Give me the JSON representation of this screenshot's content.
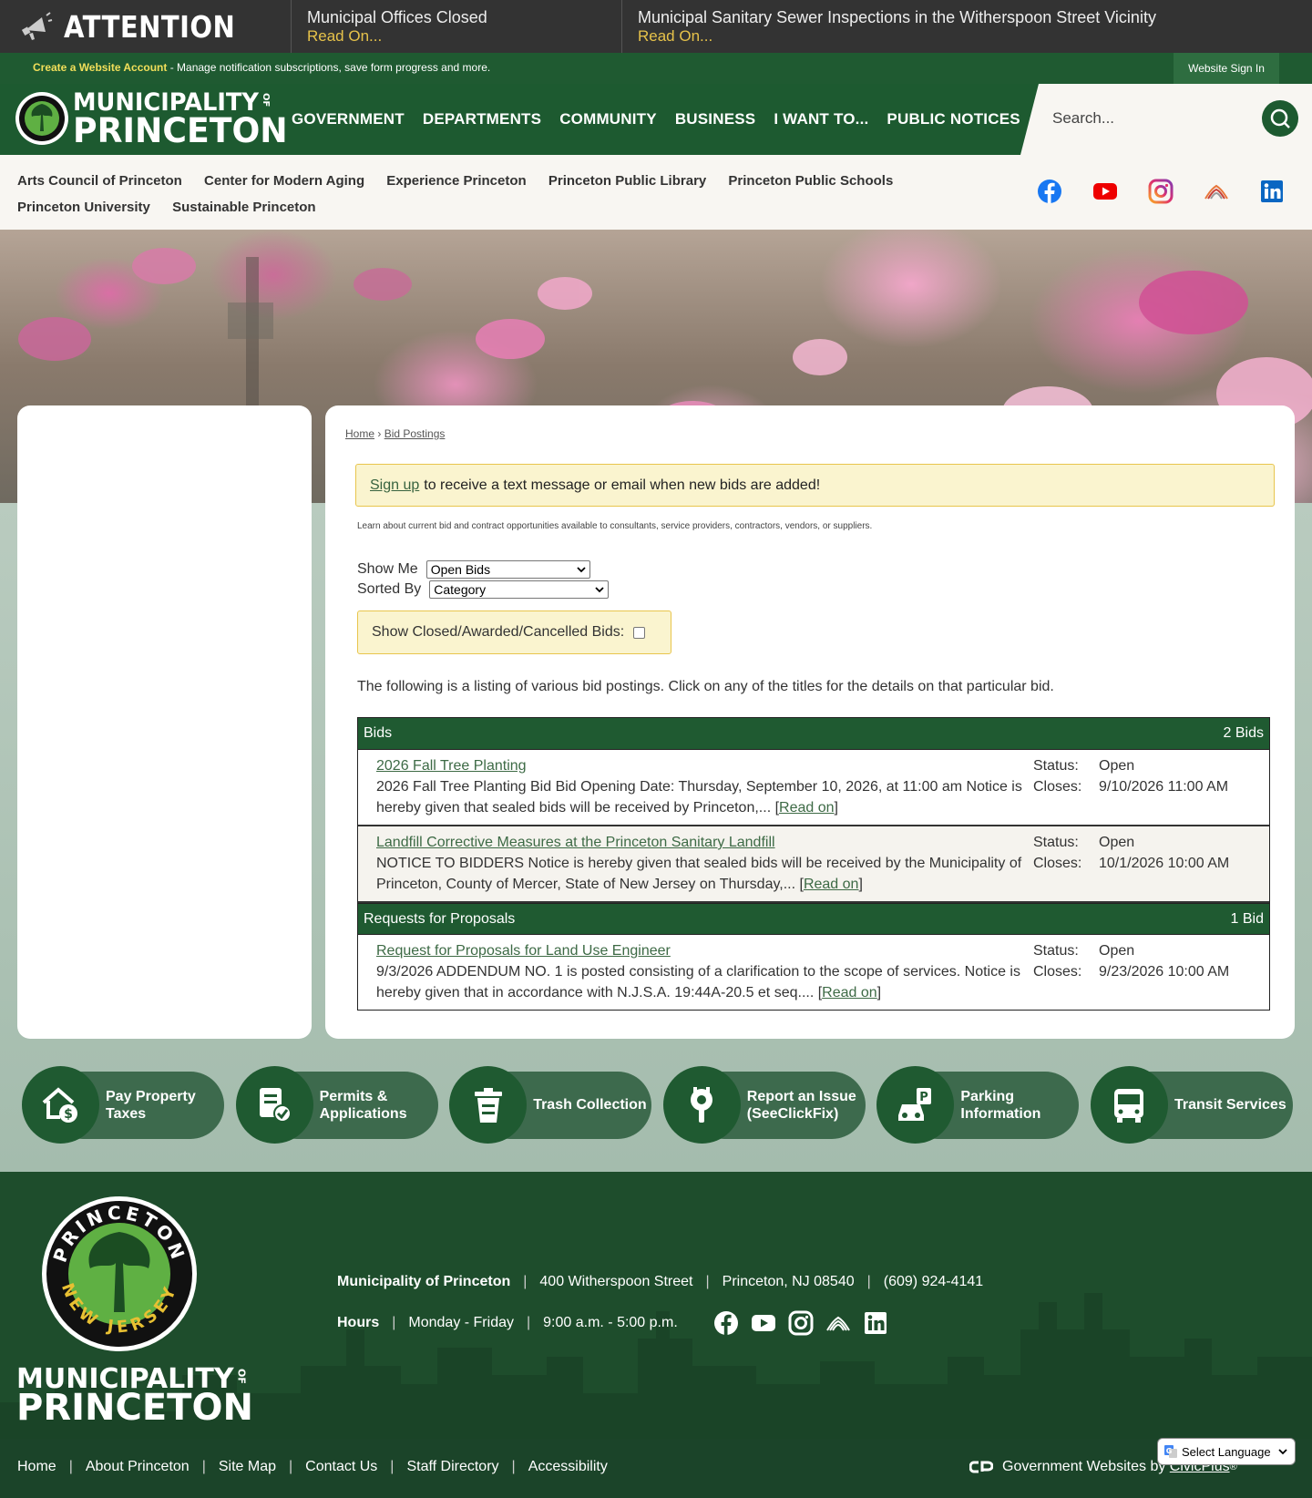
{
  "alert": {
    "title": "ATTENTION",
    "items": [
      {
        "title": "Municipal Offices Closed",
        "link": "Read On..."
      },
      {
        "title": "Municipal Sanitary Sewer Inspections in the Witherspoon Street Vicinity",
        "link": "Read On..."
      }
    ]
  },
  "account": {
    "create": "Create a Website Account",
    "desc": " - Manage notification subscriptions, save form progress and more.",
    "signin": "Website Sign In"
  },
  "logo": {
    "line1": "MUNICIPALITY",
    "of": "OF",
    "line2": "PRINCETON"
  },
  "nav": [
    "GOVERNMENT",
    "DEPARTMENTS",
    "COMMUNITY",
    "BUSINESS",
    "I WANT TO...",
    "PUBLIC NOTICES"
  ],
  "search": {
    "placeholder": "Search..."
  },
  "subnav": [
    "Arts Council of Princeton",
    "Center for Modern Aging",
    "Experience Princeton",
    "Princeton Public Library",
    "Princeton Public Schools",
    "Princeton University",
    "Sustainable Princeton"
  ],
  "social_icons": [
    "facebook-icon",
    "youtube-icon",
    "instagram-icon",
    "flickr-icon",
    "linkedin-icon"
  ],
  "breadcrumb": {
    "home": "Home",
    "sep": "›",
    "current": "Bid Postings"
  },
  "notice": {
    "link": "Sign up",
    "text": "to receive a text message or email when new bids are added!"
  },
  "learn": "Learn about current bid and contract opportunities available to consultants, service providers, contractors, vendors, or suppliers.",
  "filters": {
    "show_me_label": "Show Me",
    "show_me_value": "Open Bids",
    "sorted_by_label": "Sorted By",
    "sorted_by_value": "Category",
    "closed_label": "Show Closed/Awarded/Cancelled Bids:"
  },
  "intro": "The following is a listing of various bid postings. Click on any of the titles for the details on that particular bid.",
  "categories": [
    {
      "name": "Bids",
      "count": "2 Bids",
      "bids": [
        {
          "title": "2026 Fall Tree Planting",
          "desc": "2026 Fall Tree Planting Bid Bid Opening Date: Thursday, September 10, 2026, at 11:00 am Notice is hereby given that sealed bids will be received by Princeton,...",
          "read": "Read on",
          "status_label": "Status:",
          "status": "Open",
          "closes_label": "Closes:",
          "closes": "9/10/2026 11:00 AM"
        },
        {
          "title": "Landfill Corrective Measures at the Princeton Sanitary Landfill",
          "desc": "NOTICE TO BIDDERS Notice is hereby given that sealed bids will be received by the Municipality of Princeton, County of Mercer, State of New Jersey on Thursday,...",
          "read": "Read on",
          "status_label": "Status:",
          "status": "Open",
          "closes_label": "Closes:",
          "closes": "10/1/2026 10:00 AM"
        }
      ]
    },
    {
      "name": "Requests for Proposals",
      "count": "1 Bid",
      "bids": [
        {
          "title": "Request for Proposals for Land Use Engineer",
          "desc": "9/3/2026 ADDENDUM NO. 1 is posted consisting of a clarification to the scope of services. Notice is hereby given that in accordance with N.J.S.A. 19:44A-20.5 et seq....",
          "read": "Read on",
          "status_label": "Status:",
          "status": "Open",
          "closes_label": "Closes:",
          "closes": "9/23/2026 10:00 AM"
        }
      ]
    }
  ],
  "quick_links": [
    {
      "label": "Pay Property Taxes",
      "icon": "house-dollar-icon"
    },
    {
      "label": "Permits & Applications",
      "icon": "permit-document-icon"
    },
    {
      "label": "Trash Collection",
      "icon": "trash-can-icon"
    },
    {
      "label": "Report an Issue (SeeClickFix)",
      "icon": "wrench-gear-icon"
    },
    {
      "label": "Parking Information",
      "icon": "parking-car-icon"
    },
    {
      "label": "Transit Services",
      "icon": "bus-icon"
    }
  ],
  "footer": {
    "seal_text": {
      "top": "PRINCETON",
      "bottom": "NEW JERSEY"
    },
    "name": "Municipality of Princeton",
    "address": "400 Witherspoon Street",
    "city": "Princeton, NJ 08540",
    "phone": "(609) 924-4141",
    "hours_label": "Hours",
    "days": "Monday - Friday",
    "time": "9:00 a.m. - 5:00 p.m.",
    "links": [
      "Home",
      "About Princeton",
      "Site Map",
      "Contact Us",
      "Staff Directory",
      "Accessibility"
    ],
    "credit_text": "Government Websites by",
    "credit_link": "CivicPlus",
    "credit_mark": "®"
  },
  "language": {
    "label": "Select Language"
  }
}
